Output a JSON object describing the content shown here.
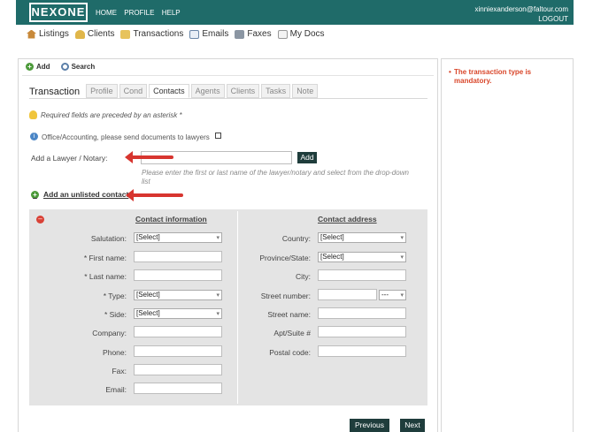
{
  "header": {
    "logo": "NEXONE",
    "nav": [
      "HOME",
      "PROFILE",
      "HELP"
    ],
    "user_email": "xinniexanderson@faltour.com",
    "logout": "LOGOUT"
  },
  "secondary_nav": [
    {
      "label": "Listings",
      "icon": "home-icon"
    },
    {
      "label": "Clients",
      "icon": "clients-icon"
    },
    {
      "label": "Transactions",
      "icon": "folder-icon"
    },
    {
      "label": "Emails",
      "icon": "mail-icon"
    },
    {
      "label": "Faxes",
      "icon": "fax-icon"
    },
    {
      "label": "My Docs",
      "icon": "docs-icon"
    }
  ],
  "toolbar": {
    "add": "Add",
    "search": "Search"
  },
  "tabs": {
    "title": "Transaction",
    "items": [
      "Profile",
      "Cond",
      "Contacts",
      "Agents",
      "Clients",
      "Tasks",
      "Note"
    ],
    "active": "Contacts"
  },
  "notes": {
    "required": "Required fields are preceded by an asterisk *",
    "office": "Office/Accounting, please send documents to lawyers"
  },
  "lawyer": {
    "label": "Add a Lawyer / Notary:",
    "value": "",
    "button": "Add",
    "hint": "Please enter the first or last name of the lawyer/notary and select from the drop-down list"
  },
  "add_unlisted": "Add an unlisted contact",
  "contact_info": {
    "heading": "Contact information",
    "salutation_label": "Salutation:",
    "salutation_value": "[Select]",
    "first_name_label": "* First name:",
    "last_name_label": "* Last name:",
    "type_label": "* Type:",
    "type_value": "[Select]",
    "side_label": "* Side:",
    "side_value": "[Select]",
    "company_label": "Company:",
    "phone_label": "Phone:",
    "fax_label": "Fax:",
    "email_label": "Email:"
  },
  "contact_address": {
    "heading": "Contact address",
    "country_label": "Country:",
    "country_value": "[Select]",
    "province_label": "Province/State:",
    "province_value": "[Select]",
    "city_label": "City:",
    "street_number_label": "Street number:",
    "street_number_suffix": "---",
    "street_name_label": "Street name:",
    "apt_label": "Apt/Suite #",
    "postal_label": "Postal code:"
  },
  "buttons": {
    "previous": "Previous",
    "next": "Next"
  },
  "error": "The transaction type is mandatory.",
  "colors": {
    "header": "#1f6b69",
    "error": "#d9472b",
    "arrow": "#d7352f",
    "dark_button": "#1f3d3c"
  }
}
